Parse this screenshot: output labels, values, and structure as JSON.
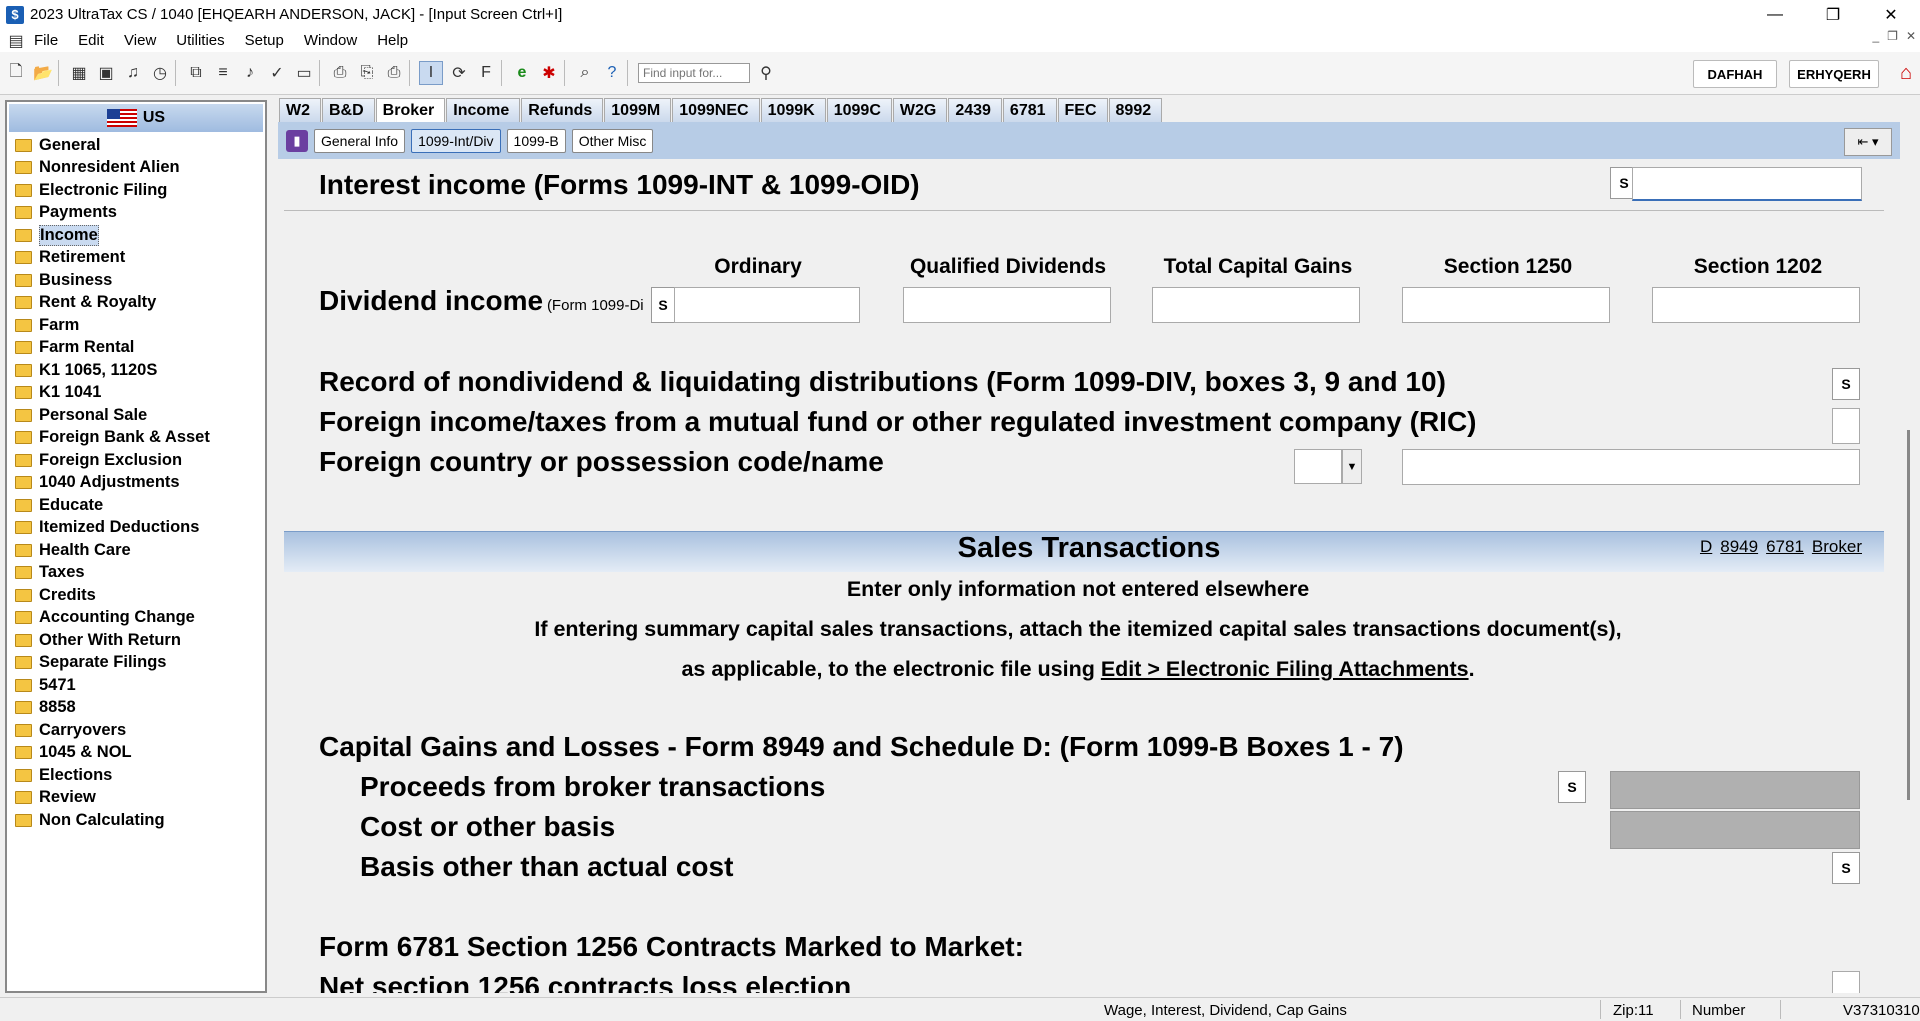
{
  "window": {
    "title": "2023 UltraTax CS  / 1040 [EHQEARH ANDERSON, JACK] - [Input Screen     Ctrl+I]",
    "minimize": "—",
    "restore": "❐",
    "close": "✕"
  },
  "menu": [
    "File",
    "Edit",
    "View",
    "Utilities",
    "Setup",
    "Window",
    "Help"
  ],
  "toolbar": {
    "find_placeholder": "Find input for...",
    "user1": "DAFHAH",
    "user2": "ERHYQERH"
  },
  "sidebar": {
    "header": "US",
    "items": [
      "General",
      "Nonresident Alien",
      "Electronic Filing",
      "Payments",
      "Income",
      "Retirement",
      "Business",
      "Rent & Royalty",
      "Farm",
      "Farm Rental",
      "K1 1065, 1120S",
      "K1 1041",
      "Personal Sale",
      "Foreign Bank & Asset",
      "Foreign Exclusion",
      "1040 Adjustments",
      "Educate",
      "Itemized Deductions",
      "Health Care",
      "Taxes",
      "Credits",
      "Accounting Change",
      "Other With Return",
      "Separate Filings",
      "5471",
      "8858",
      "Carryovers",
      "1045 & NOL",
      "Elections",
      "Review",
      "Non Calculating"
    ],
    "active": "Income"
  },
  "tabs": [
    "W2",
    "B&D",
    "Broker",
    "Income",
    "Refunds",
    "1099M",
    "1099NEC",
    "1099K",
    "1099C",
    "W2G",
    "2439",
    "6781",
    "FEC",
    "8992"
  ],
  "active_tab": "Broker",
  "subtabs": [
    "General Info",
    "1099-Int/Div",
    "1099-B",
    "Other Misc"
  ],
  "active_subtab": "1099-Int/Div",
  "form": {
    "interest_label": "Interest income (Forms 1099-INT & 1099-OID)",
    "s": "S",
    "dividend_label": "Dividend income",
    "dividend_sub": "(Form 1099-Di",
    "col_ordinary": "Ordinary",
    "col_qualified": "Qualified Dividends",
    "col_total_cap": "Total Capital Gains",
    "col_1250": "Section 1250",
    "col_1202": "Section 1202",
    "nondividend_label": "Record of nondividend & liquidating distributions (Form 1099-DIV, boxes 3, 9 and 10)",
    "foreign_tax_label": "Foreign income/taxes from a mutual fund or other regulated investment company (RIC)",
    "foreign_country_label": "Foreign country or possession code/name",
    "sales_title": "Sales Transactions",
    "sales_links": [
      "D",
      "8949",
      "6781",
      "Broker"
    ],
    "sales_note1": "Enter only information not entered elsewhere",
    "sales_note2": "If entering summary capital sales transactions, attach the itemized capital sales transactions document(s),",
    "sales_note3_pre": "as applicable, to the electronic file using ",
    "sales_note3_link": "Edit > Electronic Filing Attachments",
    "sales_note3_post": ".",
    "capgains_label": "Capital Gains and Losses - Form 8949 and Schedule D: (Form 1099-B Boxes 1 - 7)",
    "proceeds_label": "Proceeds from broker transactions",
    "cost_label": "Cost or other basis",
    "basis_other_label": "Basis other than actual cost",
    "form6781_label": "Form 6781 Section 1256 Contracts Marked to Market:",
    "net1256_label": "Net section 1256 contracts loss election"
  },
  "status": {
    "description": "Wage, Interest, Dividend, Cap Gains",
    "zip": "Zip:11",
    "mode": "Number",
    "version": "V37310310"
  }
}
